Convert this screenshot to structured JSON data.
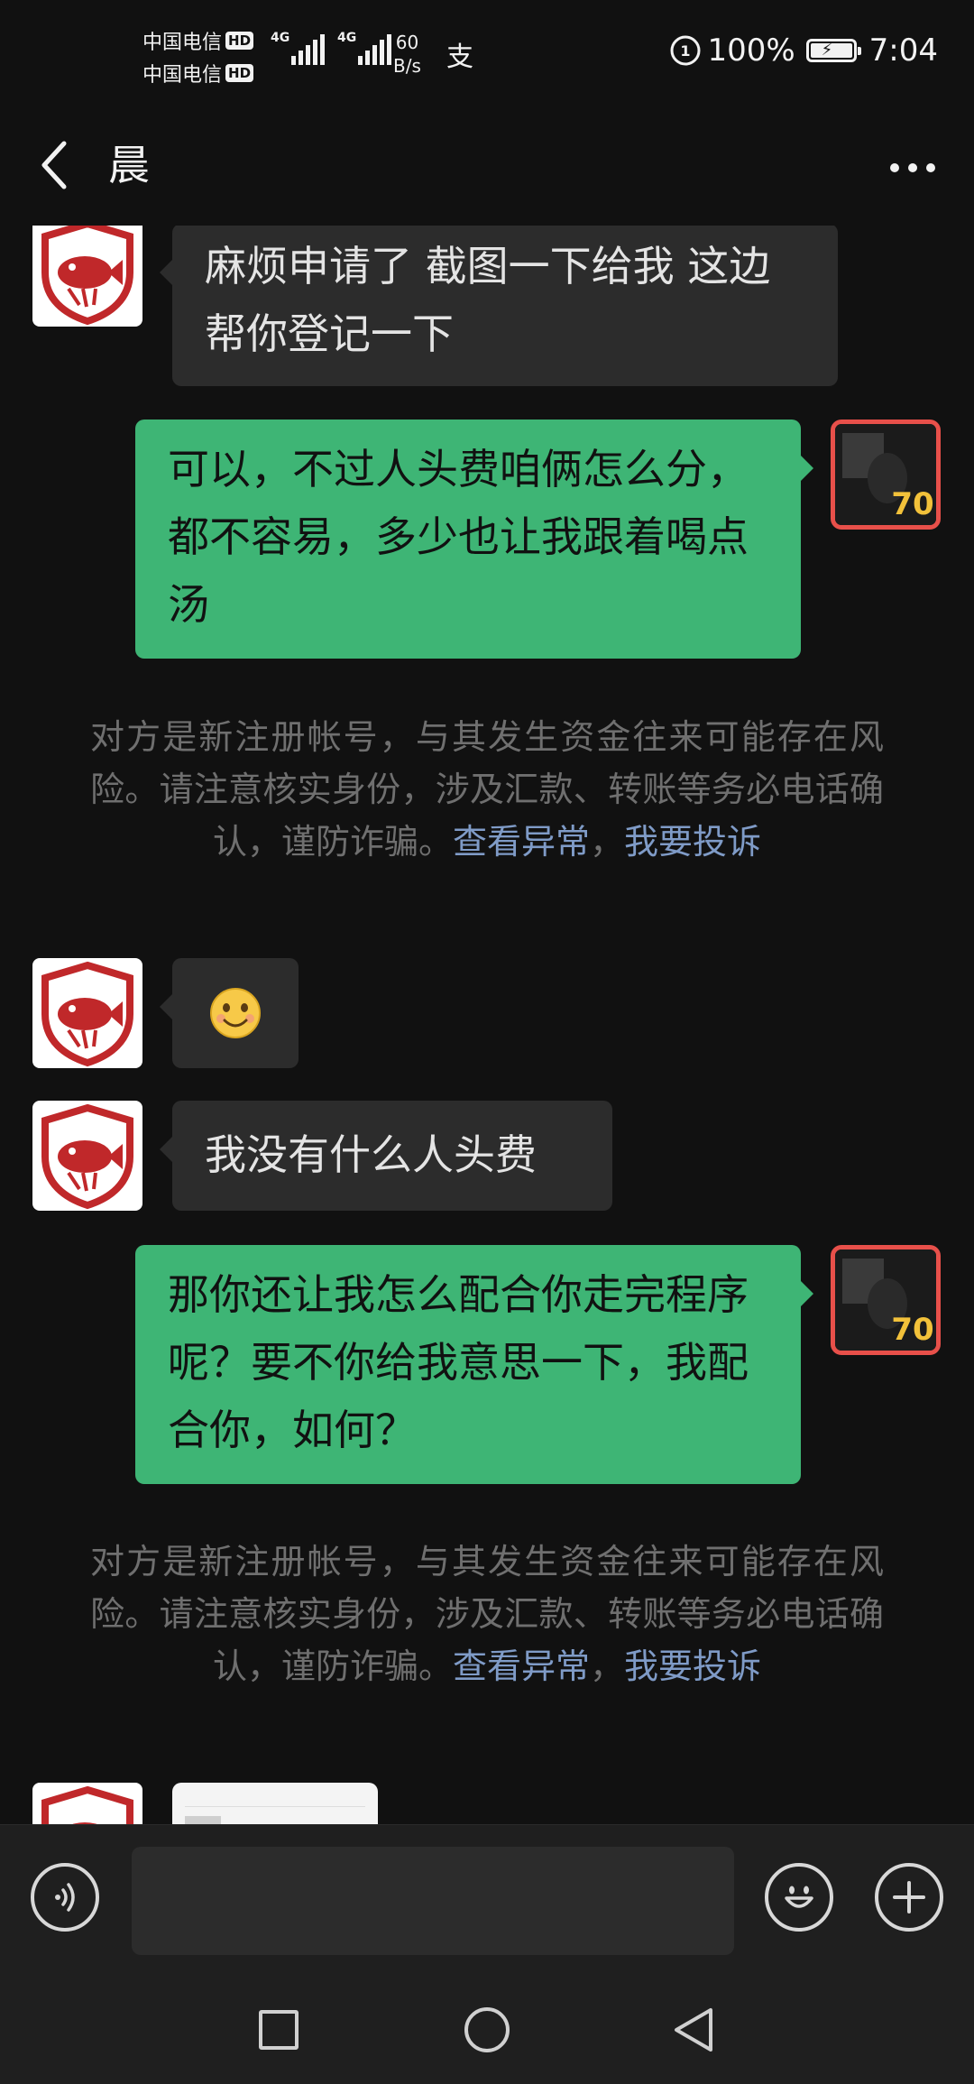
{
  "status_bar": {
    "carrier_1": "中国电信",
    "carrier_2": "中国电信",
    "hd_badge": "HD",
    "network_1": "4G",
    "network_2": "4G",
    "speed_value": "60",
    "speed_unit": "B/s",
    "alipay_icon": "支",
    "battery": "100%",
    "time": "7:04",
    "battery_level": 1.0
  },
  "header": {
    "back_icon": "chevron-left-icon",
    "title": "晨",
    "more_icon": "ellipsis-icon"
  },
  "messages": [
    {
      "side": "in",
      "text": "麻烦申请了  截图一下给我  这边帮你登记一下"
    },
    {
      "side": "out",
      "text": "可以，不过人头费咱俩怎么分，都不容易，多少也让我跟着喝点汤"
    },
    {
      "side": "in",
      "text": "我没有什么人头费"
    },
    {
      "side": "out",
      "text": "那你还让我怎么配合你走完程序呢？要不你给我意思一下，我配合你，如何？"
    }
  ],
  "notice": {
    "text": "对方是新注册帐号，与其发生资金往来可能存在风险。请注意核实身份，涉及汇款、转账等务必电话确认，谨防诈骗。",
    "link_1": "查看异常",
    "separator": "，",
    "link_2": "我要投诉"
  },
  "emoji_message": "smiling-face-emoji",
  "input_bar": {
    "voice_icon": "voice-icon",
    "input_value": "",
    "emoji_icon": "emoji-icon",
    "plus_icon": "plus-icon"
  },
  "nav_bar": {
    "recent_icon": "square-icon",
    "home_icon": "circle-icon",
    "back_icon": "triangle-back-icon"
  },
  "colors": {
    "background": "#111111",
    "incoming_bubble": "#2c2c2c",
    "outgoing_bubble": "#3eb575",
    "notice_text": "#6f6f6f",
    "link": "#7f9bc7",
    "avatar_border": "#e8504a"
  }
}
